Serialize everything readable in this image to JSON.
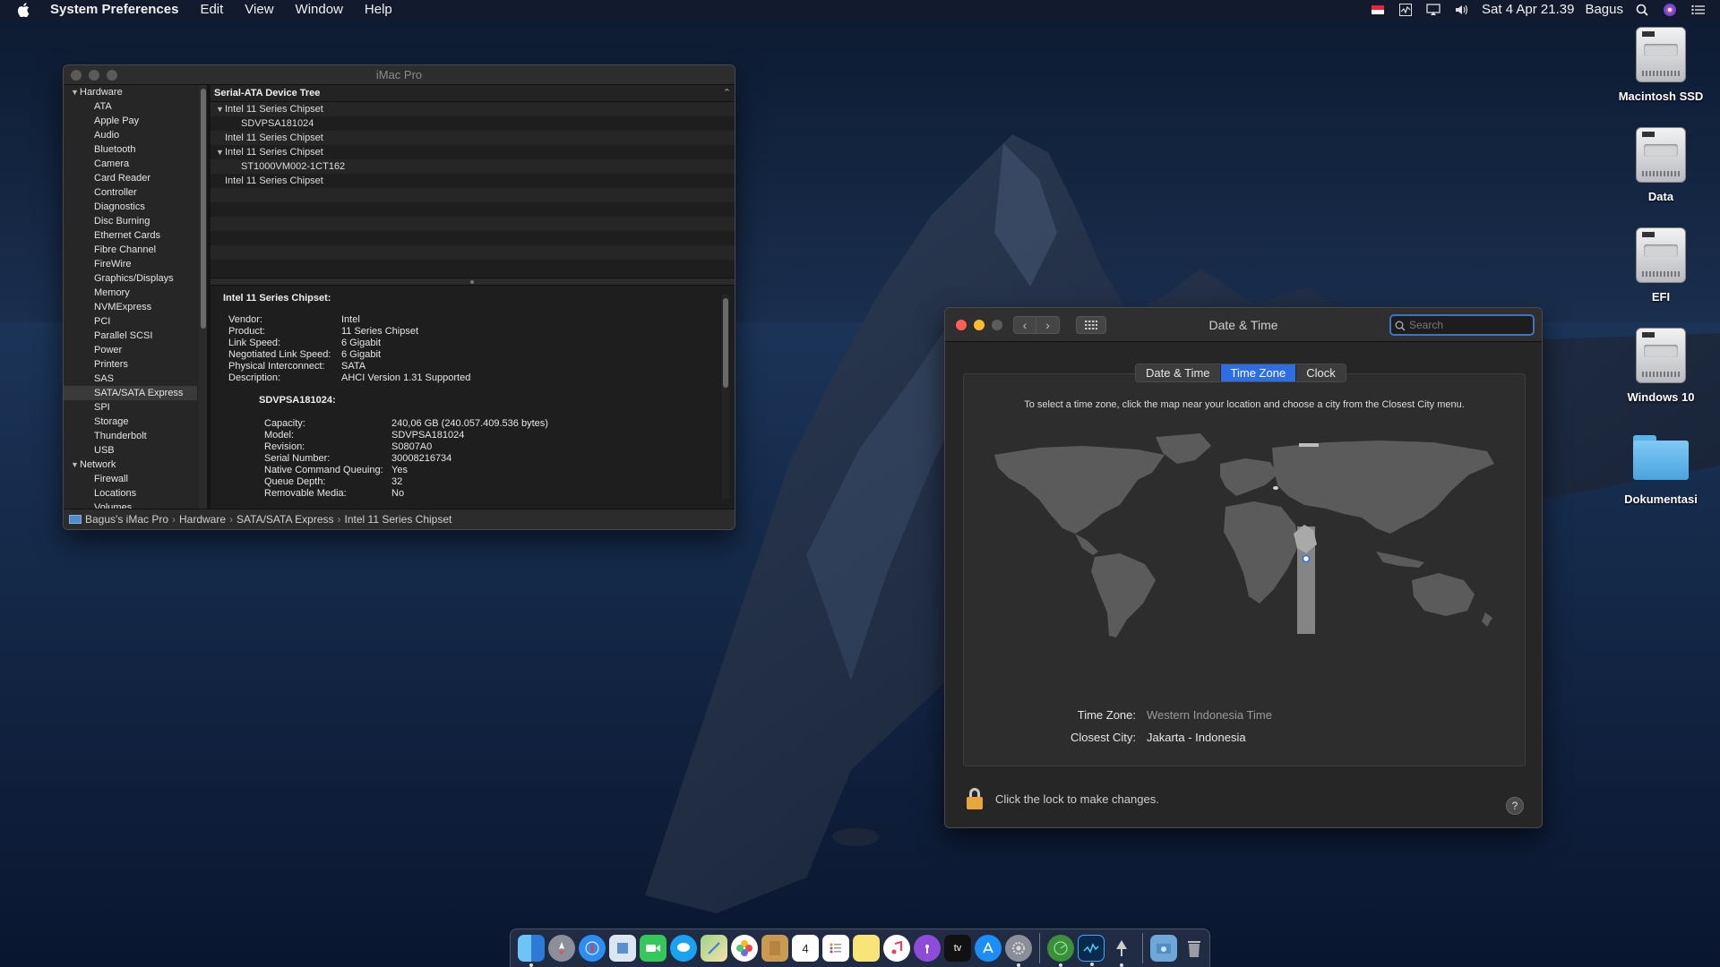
{
  "menubar": {
    "app_name": "System Preferences",
    "menus": [
      "Edit",
      "View",
      "Window",
      "Help"
    ],
    "date_time": "Sat 4 Apr  21.39",
    "user": "Bagus"
  },
  "desktop_icons": [
    "Macintosh SSD",
    "Data",
    "EFI",
    "Windows 10",
    "Dokumentasi"
  ],
  "sysinfo": {
    "title": "iMac Pro",
    "sidebar": {
      "hardware_label": "Hardware",
      "hardware_items": [
        "ATA",
        "Apple Pay",
        "Audio",
        "Bluetooth",
        "Camera",
        "Card Reader",
        "Controller",
        "Diagnostics",
        "Disc Burning",
        "Ethernet Cards",
        "Fibre Channel",
        "FireWire",
        "Graphics/Displays",
        "Memory",
        "NVMExpress",
        "PCI",
        "Parallel SCSI",
        "Power",
        "Printers",
        "SAS",
        "SATA/SATA Express",
        "SPI",
        "Storage",
        "Thunderbolt",
        "USB"
      ],
      "selected": "SATA/SATA Express",
      "network_label": "Network",
      "network_items": [
        "Firewall",
        "Locations",
        "Volumes"
      ]
    },
    "list_header": "Serial-ATA Device Tree",
    "tree": [
      {
        "label": "Intel 11 Series Chipset",
        "level": 0,
        "expanded": true
      },
      {
        "label": "SDVPSA181024",
        "level": 1
      },
      {
        "label": "Intel 11 Series Chipset",
        "level": 0
      },
      {
        "label": "Intel 11 Series Chipset",
        "level": 0,
        "expanded": true
      },
      {
        "label": "ST1000VM002-1CT162",
        "level": 1
      },
      {
        "label": "Intel 11 Series Chipset",
        "level": 0
      }
    ],
    "detail": {
      "heading": "Intel 11 Series Chipset:",
      "fields": [
        {
          "k": "Vendor:",
          "v": "Intel"
        },
        {
          "k": "Product:",
          "v": "11 Series Chipset"
        },
        {
          "k": "Link Speed:",
          "v": "6 Gigabit"
        },
        {
          "k": "Negotiated Link Speed:",
          "v": "6 Gigabit"
        },
        {
          "k": "Physical Interconnect:",
          "v": "SATA"
        },
        {
          "k": "Description:",
          "v": "AHCI Version 1.31 Supported"
        }
      ],
      "sub_heading": "SDVPSA181024:",
      "sub_fields": [
        {
          "k": "Capacity:",
          "v": "240,06 GB (240.057.409.536 bytes)"
        },
        {
          "k": "Model:",
          "v": "SDVPSA181024"
        },
        {
          "k": "Revision:",
          "v": "S0807A0"
        },
        {
          "k": "Serial Number:",
          "v": "30008216734"
        },
        {
          "k": "Native Command Queuing:",
          "v": "Yes"
        },
        {
          "k": "Queue Depth:",
          "v": "32"
        },
        {
          "k": "Removable Media:",
          "v": "No"
        }
      ]
    },
    "path": [
      "Bagus's iMac Pro",
      "Hardware",
      "SATA/SATA Express",
      "Intel 11 Series Chipset"
    ]
  },
  "datetime": {
    "title": "Date & Time",
    "search_placeholder": "Search",
    "tabs": [
      "Date & Time",
      "Time Zone",
      "Clock"
    ],
    "active_tab": "Time Zone",
    "instruction": "To select a time zone, click the map near your location and choose a city from the Closest City menu.",
    "time_zone_label": "Time Zone:",
    "time_zone_value": "Western Indonesia Time",
    "closest_city_label": "Closest City:",
    "closest_city_value": "Jakarta - Indonesia",
    "lock_text": "Click the lock to make changes.",
    "help": "?"
  },
  "dock": {
    "apps": [
      "Finder",
      "Launchpad",
      "Safari",
      "Preview",
      "FaceTime",
      "Messages",
      "Maps",
      "Photos",
      "Notes",
      "Calendar",
      "Reminders",
      "Stickies",
      "Music",
      "Podcasts",
      "TV",
      "App Store",
      "System Preferences",
      "Network Radar",
      "Activity Monitor",
      "Script Editor",
      "Downloads",
      "Trash"
    ],
    "calendar_day": "4",
    "tv_label": "tv"
  },
  "colors": {
    "accent": "#2e6ee4",
    "selection_gray": "#3a3a3a",
    "lock": "#e5a63b"
  }
}
